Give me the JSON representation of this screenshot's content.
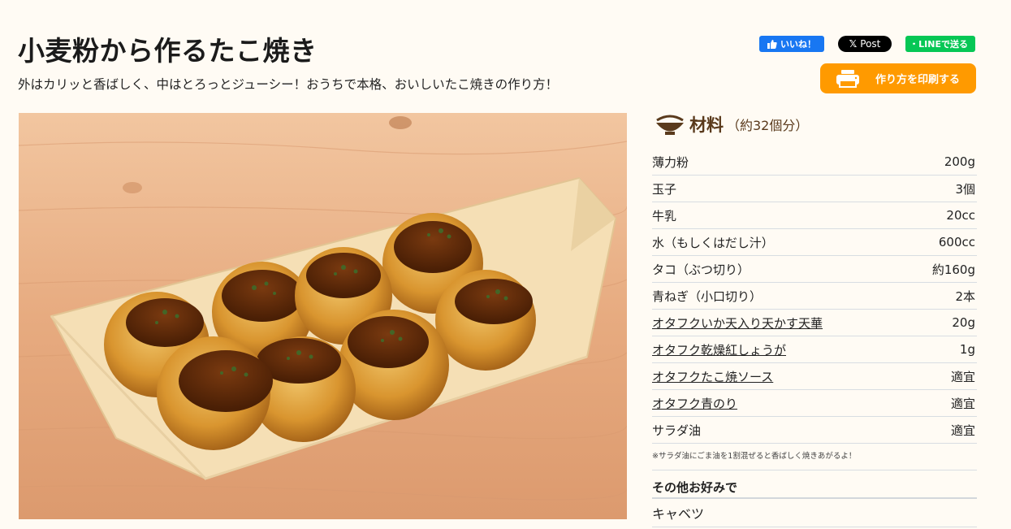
{
  "recipe": {
    "title": "小麦粉から作るたこ焼き",
    "subtitle": "外はカリッと香ばしく、中はとろっとジューシー！おうちで本格、おいしいたこ焼きの作り方！"
  },
  "share": {
    "facebook_label": "いいね！",
    "x_label": "Post",
    "line_label": "LINEで送る"
  },
  "print": {
    "label": "作り方を印刷する"
  },
  "ingredients": {
    "heading": "材料",
    "serving": "（約32個分）",
    "items": [
      {
        "name": "薄力粉",
        "amount": "200g"
      },
      {
        "name": "玉子",
        "amount": "3個"
      },
      {
        "name": "牛乳",
        "amount": "20cc"
      },
      {
        "name": "水（もしくはだし汁）",
        "amount": "600cc"
      },
      {
        "name": "タコ（ぶつ切り）",
        "amount": "約160g"
      },
      {
        "name": "青ねぎ（小口切り）",
        "amount": "2本"
      },
      {
        "name": "オタフクいか天入り天かす天華",
        "amount": "20g"
      },
      {
        "name": "オタフク乾燥紅しょうが",
        "amount": "1g"
      },
      {
        "name": "オタフクたこ焼ソース",
        "amount": "適宜"
      },
      {
        "name": "オタフク青のり",
        "amount": "適宜"
      },
      {
        "name": "サラダ油",
        "amount": "適宜"
      }
    ],
    "note": "※サラダ油にごま油を1割混ぜると香ばしく焼きあがるよ！",
    "other_heading": "その他お好みで",
    "other_items": [
      "キャベツ"
    ]
  },
  "colors": {
    "accent": "#ff9a00",
    "heading_brown": "#5a3a1c",
    "facebook": "#1877f2",
    "line": "#06c755"
  }
}
